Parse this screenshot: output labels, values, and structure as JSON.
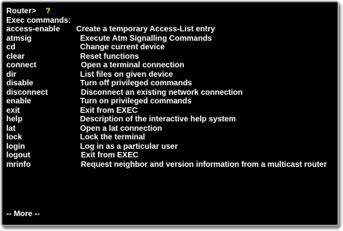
{
  "terminal": {
    "prompt": "Router>",
    "typed": "?",
    "heading": "Exec commands:",
    "commands": [
      {
        "name": "access-enable",
        "description": "Create a temporary Access-List entry"
      },
      {
        "name": "atmsig",
        "description": "Execute Atm Signalling Commands"
      },
      {
        "name": "cd",
        "description": "Change current device"
      },
      {
        "name": "clear",
        "description": "Reset functions"
      },
      {
        "name": "connect",
        "description": "Open a terminal connection"
      },
      {
        "name": "dir",
        "description": "List files on given device"
      },
      {
        "name": "disable",
        "description": "Turn off privileged commands"
      },
      {
        "name": "disconnect",
        "description": "Disconnect an existing network connection"
      },
      {
        "name": "enable",
        "description": "Turn on privileged commands"
      },
      {
        "name": "exit",
        "description": "Exit from EXEC"
      },
      {
        "name": "help",
        "description": "Description of the interactive help system"
      },
      {
        "name": "lat",
        "description": "Open a lat connection"
      },
      {
        "name": "lock",
        "description": "Lock the terminal"
      },
      {
        "name": "login",
        "description": "Log in as a particular user"
      },
      {
        "name": "logout",
        "description": "Exit from EXEC"
      },
      {
        "name": "mrinfo",
        "description": "Request neighbor and version information from a multicast router"
      }
    ],
    "more": "-- More --"
  },
  "colors": {
    "background": "#000000",
    "text": "#ffffff",
    "typed_char": "#ffff00",
    "frame_border": "#9a9a9a"
  }
}
